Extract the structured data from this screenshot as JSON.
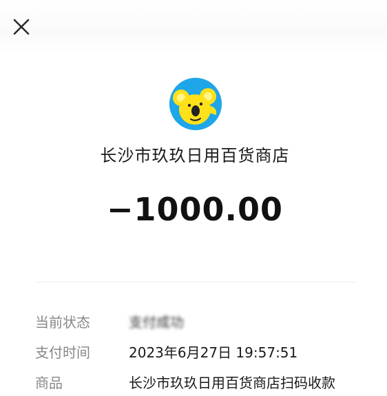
{
  "header": {
    "close_icon": "close-icon"
  },
  "merchant": {
    "logo_icon": "koala-logo",
    "name": "长沙市玖玖日用百货商店"
  },
  "transaction": {
    "amount": "−1000.00"
  },
  "details": {
    "status_label": "当前状态",
    "status_value": "支付成功",
    "time_label": "支付时间",
    "time_value": "2023年6月27日 19:57:51",
    "product_label": "商品",
    "product_value": "长沙市玖玖日用百货商店扫码收款"
  },
  "colors": {
    "logo_bg": "#1ea6e8",
    "logo_figure": "#ffe11a",
    "label_gray": "#888888",
    "text_dark": "#1a1a1a"
  }
}
